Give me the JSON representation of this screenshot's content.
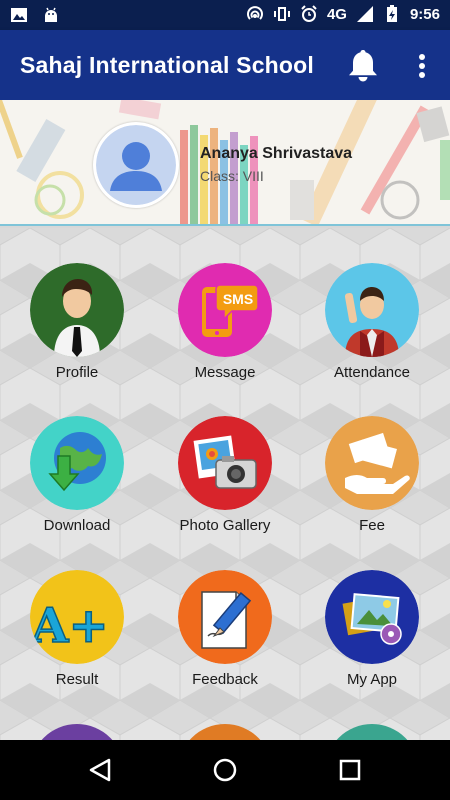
{
  "status_bar": {
    "left_icons": [
      "image-icon",
      "android-icon"
    ],
    "right_icons": [
      "hotspot-icon",
      "vibrate-icon",
      "alarm-icon",
      "signal-icon",
      "battery-icon"
    ],
    "network": "4G",
    "time": "9:56"
  },
  "app_bar": {
    "title": "Sahaj International School",
    "bell_icon": "bell-icon",
    "menu_icon": "more-vert-icon",
    "color": "#15328a"
  },
  "profile": {
    "name": "Ananya Shrivastava",
    "class_label": "Class: VIII"
  },
  "menu": {
    "items": [
      {
        "label": "Profile",
        "icon": "profile-icon",
        "color": "#2e6b2a"
      },
      {
        "label": "Message",
        "icon": "sms-icon",
        "color": "#e02bb0",
        "badge": "SMS"
      },
      {
        "label": "Attendance",
        "icon": "attendance-icon",
        "color": "#5cc6e8"
      },
      {
        "label": "Download",
        "icon": "download-icon",
        "color": "#43d3c8"
      },
      {
        "label": "Photo Gallery",
        "icon": "camera-icon",
        "color": "#d8242b"
      },
      {
        "label": "Fee",
        "icon": "fee-icon",
        "color": "#e9a24a"
      },
      {
        "label": "Result",
        "icon": "result-icon",
        "color": "#f2c319",
        "badge": "A+"
      },
      {
        "label": "Feedback",
        "icon": "feedback-icon",
        "color": "#f06a1c"
      },
      {
        "label": "My App",
        "icon": "my-app-icon",
        "color": "#1d2fa3"
      }
    ]
  },
  "nav_bar": {
    "buttons": [
      "back-icon",
      "home-icon",
      "recents-icon"
    ]
  }
}
